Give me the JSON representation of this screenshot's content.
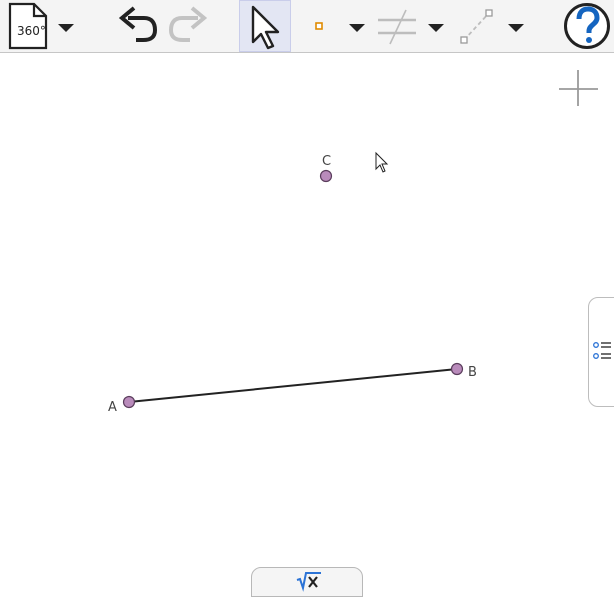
{
  "toolbar": {
    "file_menu": {
      "label": "360°",
      "icon": "document-icon"
    },
    "undo": {
      "icon": "undo-icon"
    },
    "redo": {
      "icon": "redo-icon",
      "disabled": true
    },
    "move_tool": {
      "icon": "cursor-arrow-icon",
      "selected": true
    },
    "point_tool": {
      "icon": "point-icon"
    },
    "parallel_tool": {
      "icon": "parallel-lines-icon"
    },
    "segment_tool": {
      "icon": "segment-icon"
    },
    "help": {
      "icon": "help-icon",
      "color": "#1565c0"
    }
  },
  "canvas": {
    "points": [
      {
        "name": "C",
        "label": "C"
      },
      {
        "name": "B",
        "label": "B"
      },
      {
        "name": "A",
        "label": "A"
      }
    ],
    "point_fill": "#b98bbb",
    "point_stroke": "#5a3d5c",
    "segment": {
      "from": "A",
      "to": "B"
    }
  },
  "side_panel": {
    "icon": "algebra-view-icon",
    "accent": "#2b73d6"
  },
  "input_bar": {
    "icon": "sqrt-x-icon",
    "accent": "#2b73d6"
  },
  "zoom": {
    "icon": "crosshair-icon"
  }
}
